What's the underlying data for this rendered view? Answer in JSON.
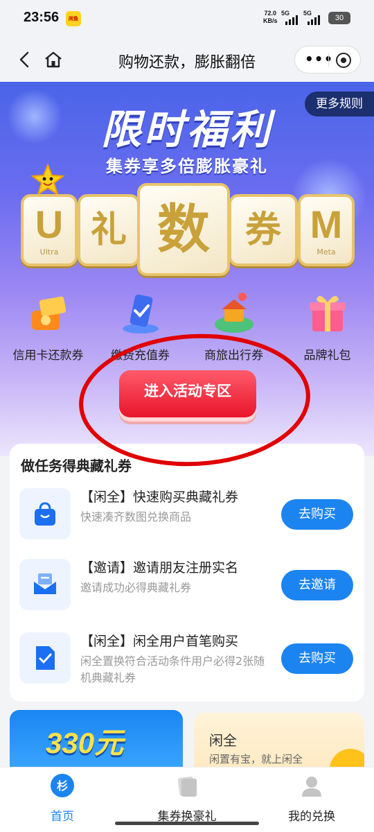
{
  "status_bar": {
    "time": "23:56",
    "app_badge": "闲鱼",
    "speed_value": "72.0",
    "speed_unit": "KB/s",
    "sig1": "5G",
    "sig2": "5G",
    "battery": "30"
  },
  "nav": {
    "title": "购物还款，膨胀翻倍",
    "more": "•••"
  },
  "hero": {
    "rules_label": "更多规则",
    "title": "限时福利",
    "subtitle": "集券享多倍膨胀豪礼",
    "cards": [
      {
        "big": "U",
        "small": "Ultra"
      },
      {
        "big": "礼",
        "small": ""
      },
      {
        "big": "数",
        "small": ""
      },
      {
        "big": "券",
        "small": ""
      },
      {
        "big": "M",
        "small": "Meta"
      }
    ],
    "categories": [
      {
        "label": "信用卡还款券",
        "icon": "credit-card-repay-icon"
      },
      {
        "label": "缴费充值券",
        "icon": "phone-recharge-icon"
      },
      {
        "label": "商旅出行券",
        "icon": "travel-icon"
      },
      {
        "label": "品牌礼包",
        "icon": "gift-box-icon"
      }
    ],
    "cta_label": "进入活动专区"
  },
  "tasks": {
    "title": "做任务得典藏礼券",
    "items": [
      {
        "title": "【闲全】快速购买典藏礼券",
        "desc": "快速凑齐数图兑换商品",
        "button": "去购买",
        "icon": "shopping-bag-icon"
      },
      {
        "title": "【邀请】邀请朋友注册实名",
        "desc": "邀请成功必得典藏礼券",
        "button": "去邀请",
        "icon": "mail-icon"
      },
      {
        "title": "【闲全】闲全用户首笔购买",
        "desc": "闲全置换符合活动条件用户必得2张随机典藏礼券",
        "button": "去购买",
        "icon": "document-check-icon"
      }
    ]
  },
  "banners": {
    "left_amount": "330元",
    "right_title": "闲全",
    "right_sub": "闲置有宝，就上闲全"
  },
  "tabbar": {
    "items": [
      {
        "label": "首页",
        "icon": "home-tab-icon",
        "active": true
      },
      {
        "label": "集券换豪礼",
        "icon": "coupon-tab-icon",
        "active": false
      },
      {
        "label": "我的兑换",
        "icon": "profile-tab-icon",
        "active": false
      }
    ]
  },
  "colors": {
    "primary_blue": "#1b84f0",
    "cta_red": "#e8142b",
    "annotation_red": "#e00000"
  }
}
